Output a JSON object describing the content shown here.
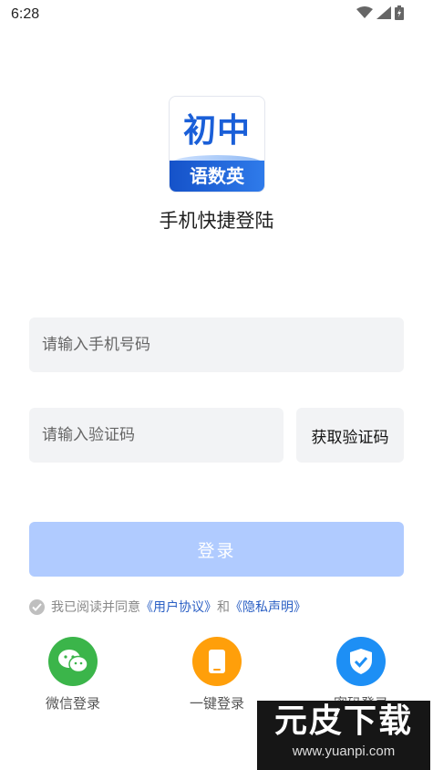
{
  "status_bar": {
    "time": "6:28"
  },
  "logo": {
    "top_text": "初中",
    "band_text": "语数英"
  },
  "title": "手机快捷登陆",
  "form": {
    "phone_placeholder": "请输入手机号码",
    "code_placeholder": "请输入验证码",
    "get_code_label": "获取验证码",
    "login_label": "登录"
  },
  "agreement": {
    "prefix": "我已阅读并同意",
    "user_agreement": "《用户协议》",
    "conjunction": "和",
    "privacy": "《隐私声明》"
  },
  "alt_logins": [
    {
      "label": "微信登录",
      "icon": "wechat-icon",
      "color": "#3bb54a"
    },
    {
      "label": "一键登录",
      "icon": "phone-icon",
      "color": "#ff9f0a"
    },
    {
      "label": "密码登录",
      "icon": "shield-check-icon",
      "color": "#1d8ff5"
    }
  ],
  "watermark": {
    "big_text": "元皮下载",
    "url": "www.yuanpi.com"
  },
  "colors": {
    "primary": "#2a5fc4",
    "login_disabled": "#b0cbff"
  }
}
